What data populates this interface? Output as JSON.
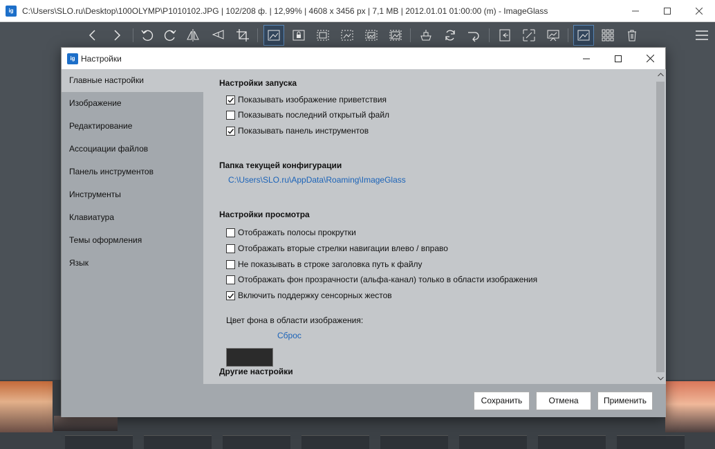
{
  "main_window": {
    "title": "C:\\Users\\SLO.ru\\Desktop\\100OLYMP\\P1010102.JPG  |  102/208 ф.  |  12,99%  |  4608 x 3456 px  |  7,1 MB  |  2012.01.01 01:00:00 (m)  - ImageGlass",
    "app_icon": "ig"
  },
  "toolbar": {
    "buttons": [
      "chevron-left-icon",
      "chevron-right-icon",
      "rotate-left-icon",
      "rotate-right-icon",
      "flip-horizontal-icon",
      "flip-vertical-icon",
      "crop-icon",
      "auto-zoom-icon",
      "lock-zoom-icon",
      "scale-width-icon",
      "scale-height-icon",
      "scale-fit-icon",
      "scale-fill-icon",
      "open-file-icon",
      "refresh-icon",
      "goto-icon",
      "thumbnail-bar-icon",
      "fullscreen-icon",
      "slideshow-icon",
      "checkerboard-icon",
      "gallery-icon",
      "delete-icon",
      "menu-icon"
    ]
  },
  "dialog": {
    "title": "Настройки",
    "sidebar": {
      "items": [
        {
          "label": "Главные настройки"
        },
        {
          "label": "Изображение"
        },
        {
          "label": "Редактирование"
        },
        {
          "label": "Ассоциации файлов"
        },
        {
          "label": "Панель инструментов"
        },
        {
          "label": "Инструменты"
        },
        {
          "label": "Клавиатура"
        },
        {
          "label": "Темы оформления"
        },
        {
          "label": "Язык"
        }
      ]
    },
    "startup": {
      "title": "Настройки запуска",
      "options": [
        {
          "label": "Показывать изображение приветствия",
          "checked": true
        },
        {
          "label": "Показывать последний открытый файл",
          "checked": false
        },
        {
          "label": "Показывать панель инструментов",
          "checked": true
        }
      ]
    },
    "config": {
      "title": "Папка текущей конфигурации",
      "path": "C:\\Users\\SLO.ru\\AppData\\Roaming\\ImageGlass"
    },
    "view": {
      "title": "Настройки просмотра",
      "options": [
        {
          "label": "Отображать полосы прокрутки",
          "checked": false
        },
        {
          "label": "Отображать вторые стрелки навигации влево / вправо",
          "checked": false
        },
        {
          "label": "Не показывать в строке заголовка путь к файлу",
          "checked": false
        },
        {
          "label": "Отображать фон прозрачности (альфа-канал) только в области изображения",
          "checked": false
        },
        {
          "label": "Включить поддержку сенсорных жестов",
          "checked": true
        }
      ],
      "bg_color_label": "Цвет фона  в области изображения:",
      "bg_color": "#2b2b2b",
      "reset_label": "Сброс"
    },
    "other": {
      "title": "Другие настройки"
    },
    "buttons": {
      "save": "Сохранить",
      "cancel": "Отмена",
      "apply": "Применить"
    }
  }
}
